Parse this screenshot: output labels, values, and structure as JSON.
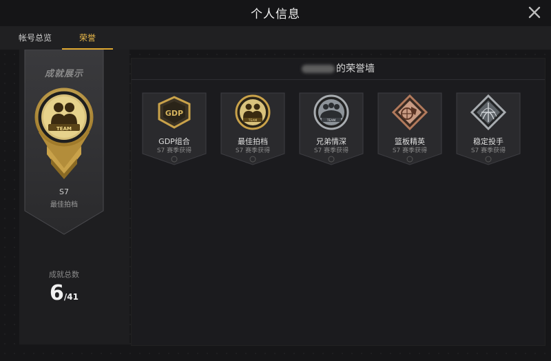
{
  "window": {
    "title": "个人信息"
  },
  "tabs": [
    {
      "label": "帐号总览",
      "active": false
    },
    {
      "label": "荣誉",
      "active": true
    }
  ],
  "left_panel": {
    "title": "成就展示",
    "badge_text": "TEAM",
    "season": "S7",
    "season_label": "最佳拍档",
    "total_label": "成就总数",
    "total_count": "6",
    "total_max": "/41"
  },
  "wall": {
    "title_suffix": "的荣誉墙",
    "badges": [
      {
        "name": "GDP组合",
        "subtitle": "S7 赛季获得",
        "icon": "gdp-badge-icon",
        "emblem_text": "GDP"
      },
      {
        "name": "最佳拍档",
        "subtitle": "S7 赛季获得",
        "icon": "team-badge-icon",
        "emblem_text": "TEAM"
      },
      {
        "name": "兄弟情深",
        "subtitle": "S7 赛季获得",
        "icon": "brothers-badge-icon",
        "emblem_text": "TEAM"
      },
      {
        "name": "篮板精英",
        "subtitle": "S7 赛季获得",
        "icon": "rebound-badge-icon",
        "emblem_text": ""
      },
      {
        "name": "稳定投手",
        "subtitle": "S7 赛季获得",
        "icon": "shooter-badge-icon",
        "emblem_text": ""
      }
    ]
  },
  "colors": {
    "accent": "#e0a930",
    "gold": "#c9a24a",
    "silver": "#a8acb0",
    "bronze": "#b27a5c"
  }
}
